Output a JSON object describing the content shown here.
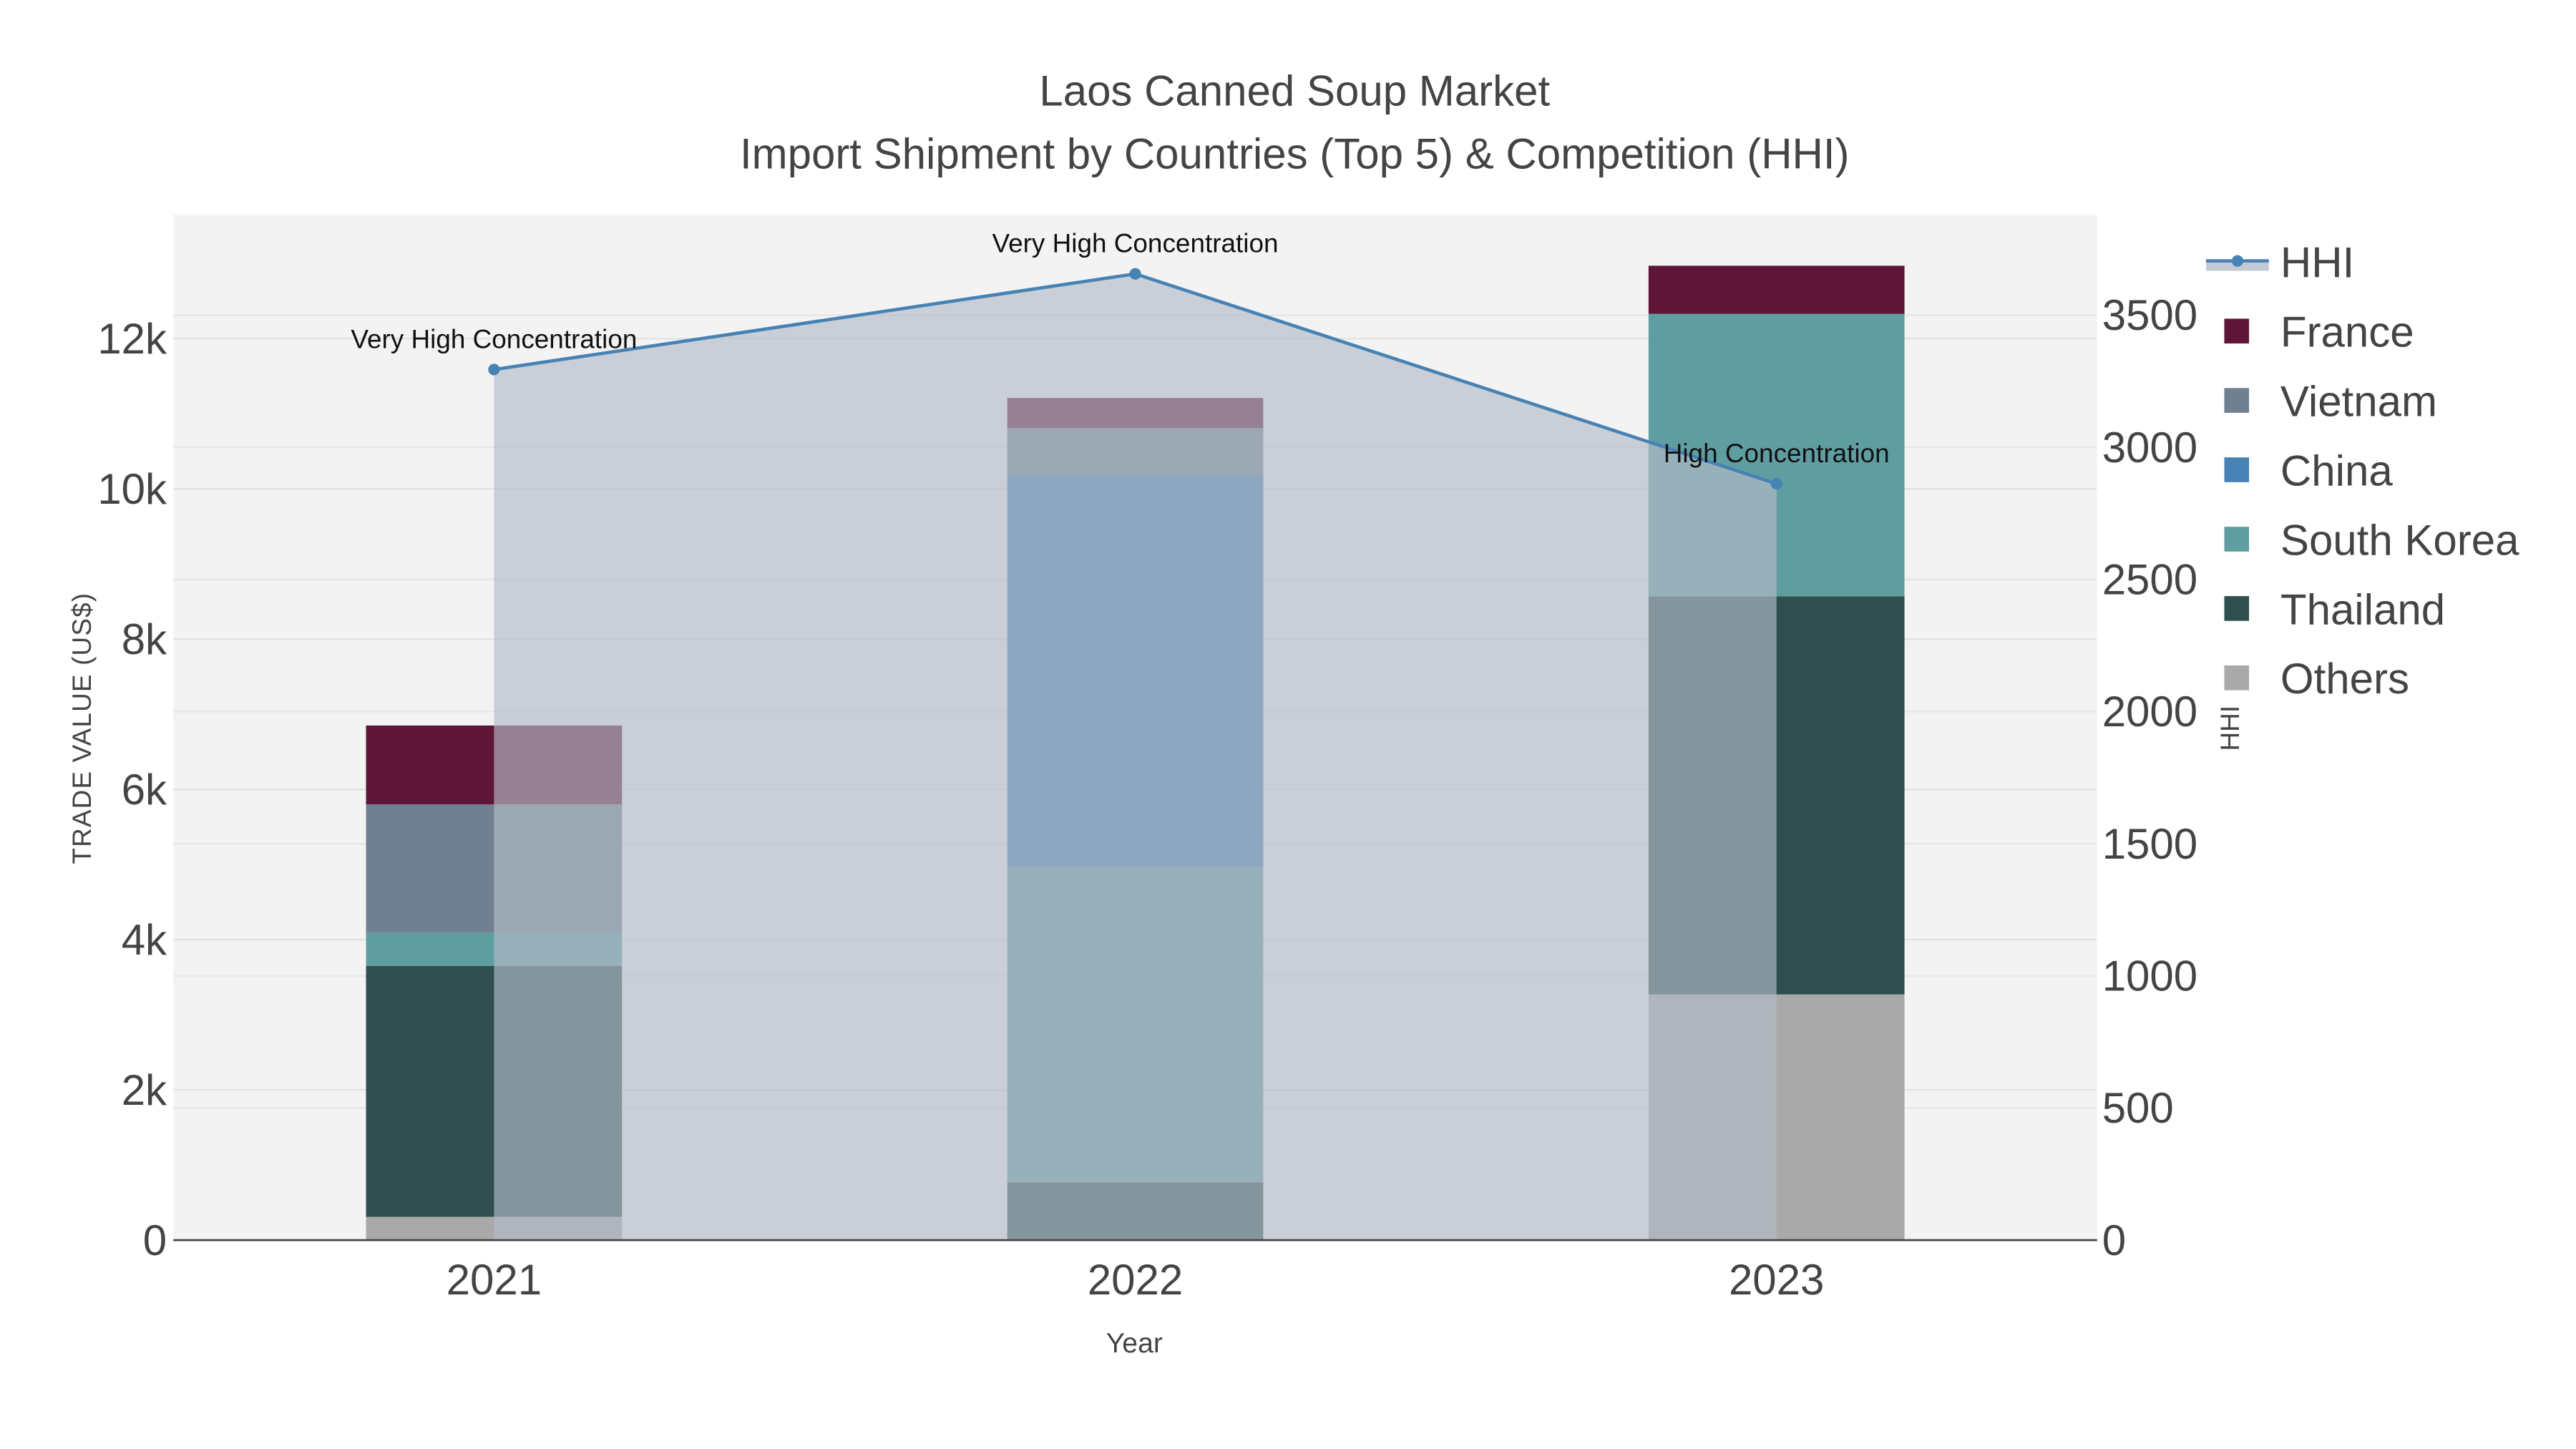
{
  "chart_data": {
    "type": "bar",
    "title": "Laos Canned Soup Market",
    "subtitle": "Import Shipment by Countries (Top 5) & Competition (HHI)",
    "xlabel": "Year",
    "ylabel": "TRADE VALUE (US$)",
    "y2label": "HHI",
    "categories": [
      "2021",
      "2022",
      "2023"
    ],
    "ylim": [
      0,
      13650
    ],
    "y2lim": [
      0,
      3880
    ],
    "yticks": [
      0,
      2000,
      4000,
      6000,
      8000,
      10000,
      12000
    ],
    "yticklabels": [
      "0",
      "2k",
      "4k",
      "6k",
      "8k",
      "10k",
      "12k"
    ],
    "y2ticks": [
      0,
      500,
      1000,
      1500,
      2000,
      2500,
      3000,
      3500
    ],
    "y2ticklabels": [
      "0",
      "500",
      "1000",
      "1500",
      "2000",
      "2500",
      "3000",
      "3500"
    ],
    "grid": true,
    "legend_placement": "right",
    "series": [
      {
        "name": "Others",
        "color": "#a9a9a9",
        "values": [
          310,
          0,
          3270
        ]
      },
      {
        "name": "Thailand",
        "color": "#2f4f4f",
        "values": [
          3340,
          770,
          5300
        ]
      },
      {
        "name": "South Korea",
        "color": "#5f9ea0",
        "values": [
          440,
          4200,
          3760
        ]
      },
      {
        "name": "China",
        "color": "#4682b4",
        "values": [
          0,
          5210,
          0
        ]
      },
      {
        "name": "Vietnam",
        "color": "#708090",
        "values": [
          1710,
          630,
          0
        ]
      },
      {
        "name": "France",
        "color": "#5f1535",
        "values": [
          1050,
          400,
          640
        ]
      }
    ],
    "hhi": {
      "name": "HHI",
      "color": "#4682b4",
      "values": [
        3294,
        3656,
        2862
      ],
      "annotations": [
        "Very High Concentration",
        "Very High Concentration",
        "High Concentration"
      ]
    },
    "legend_order": [
      "HHI",
      "France",
      "Vietnam",
      "China",
      "South Korea",
      "Thailand",
      "Others"
    ]
  }
}
